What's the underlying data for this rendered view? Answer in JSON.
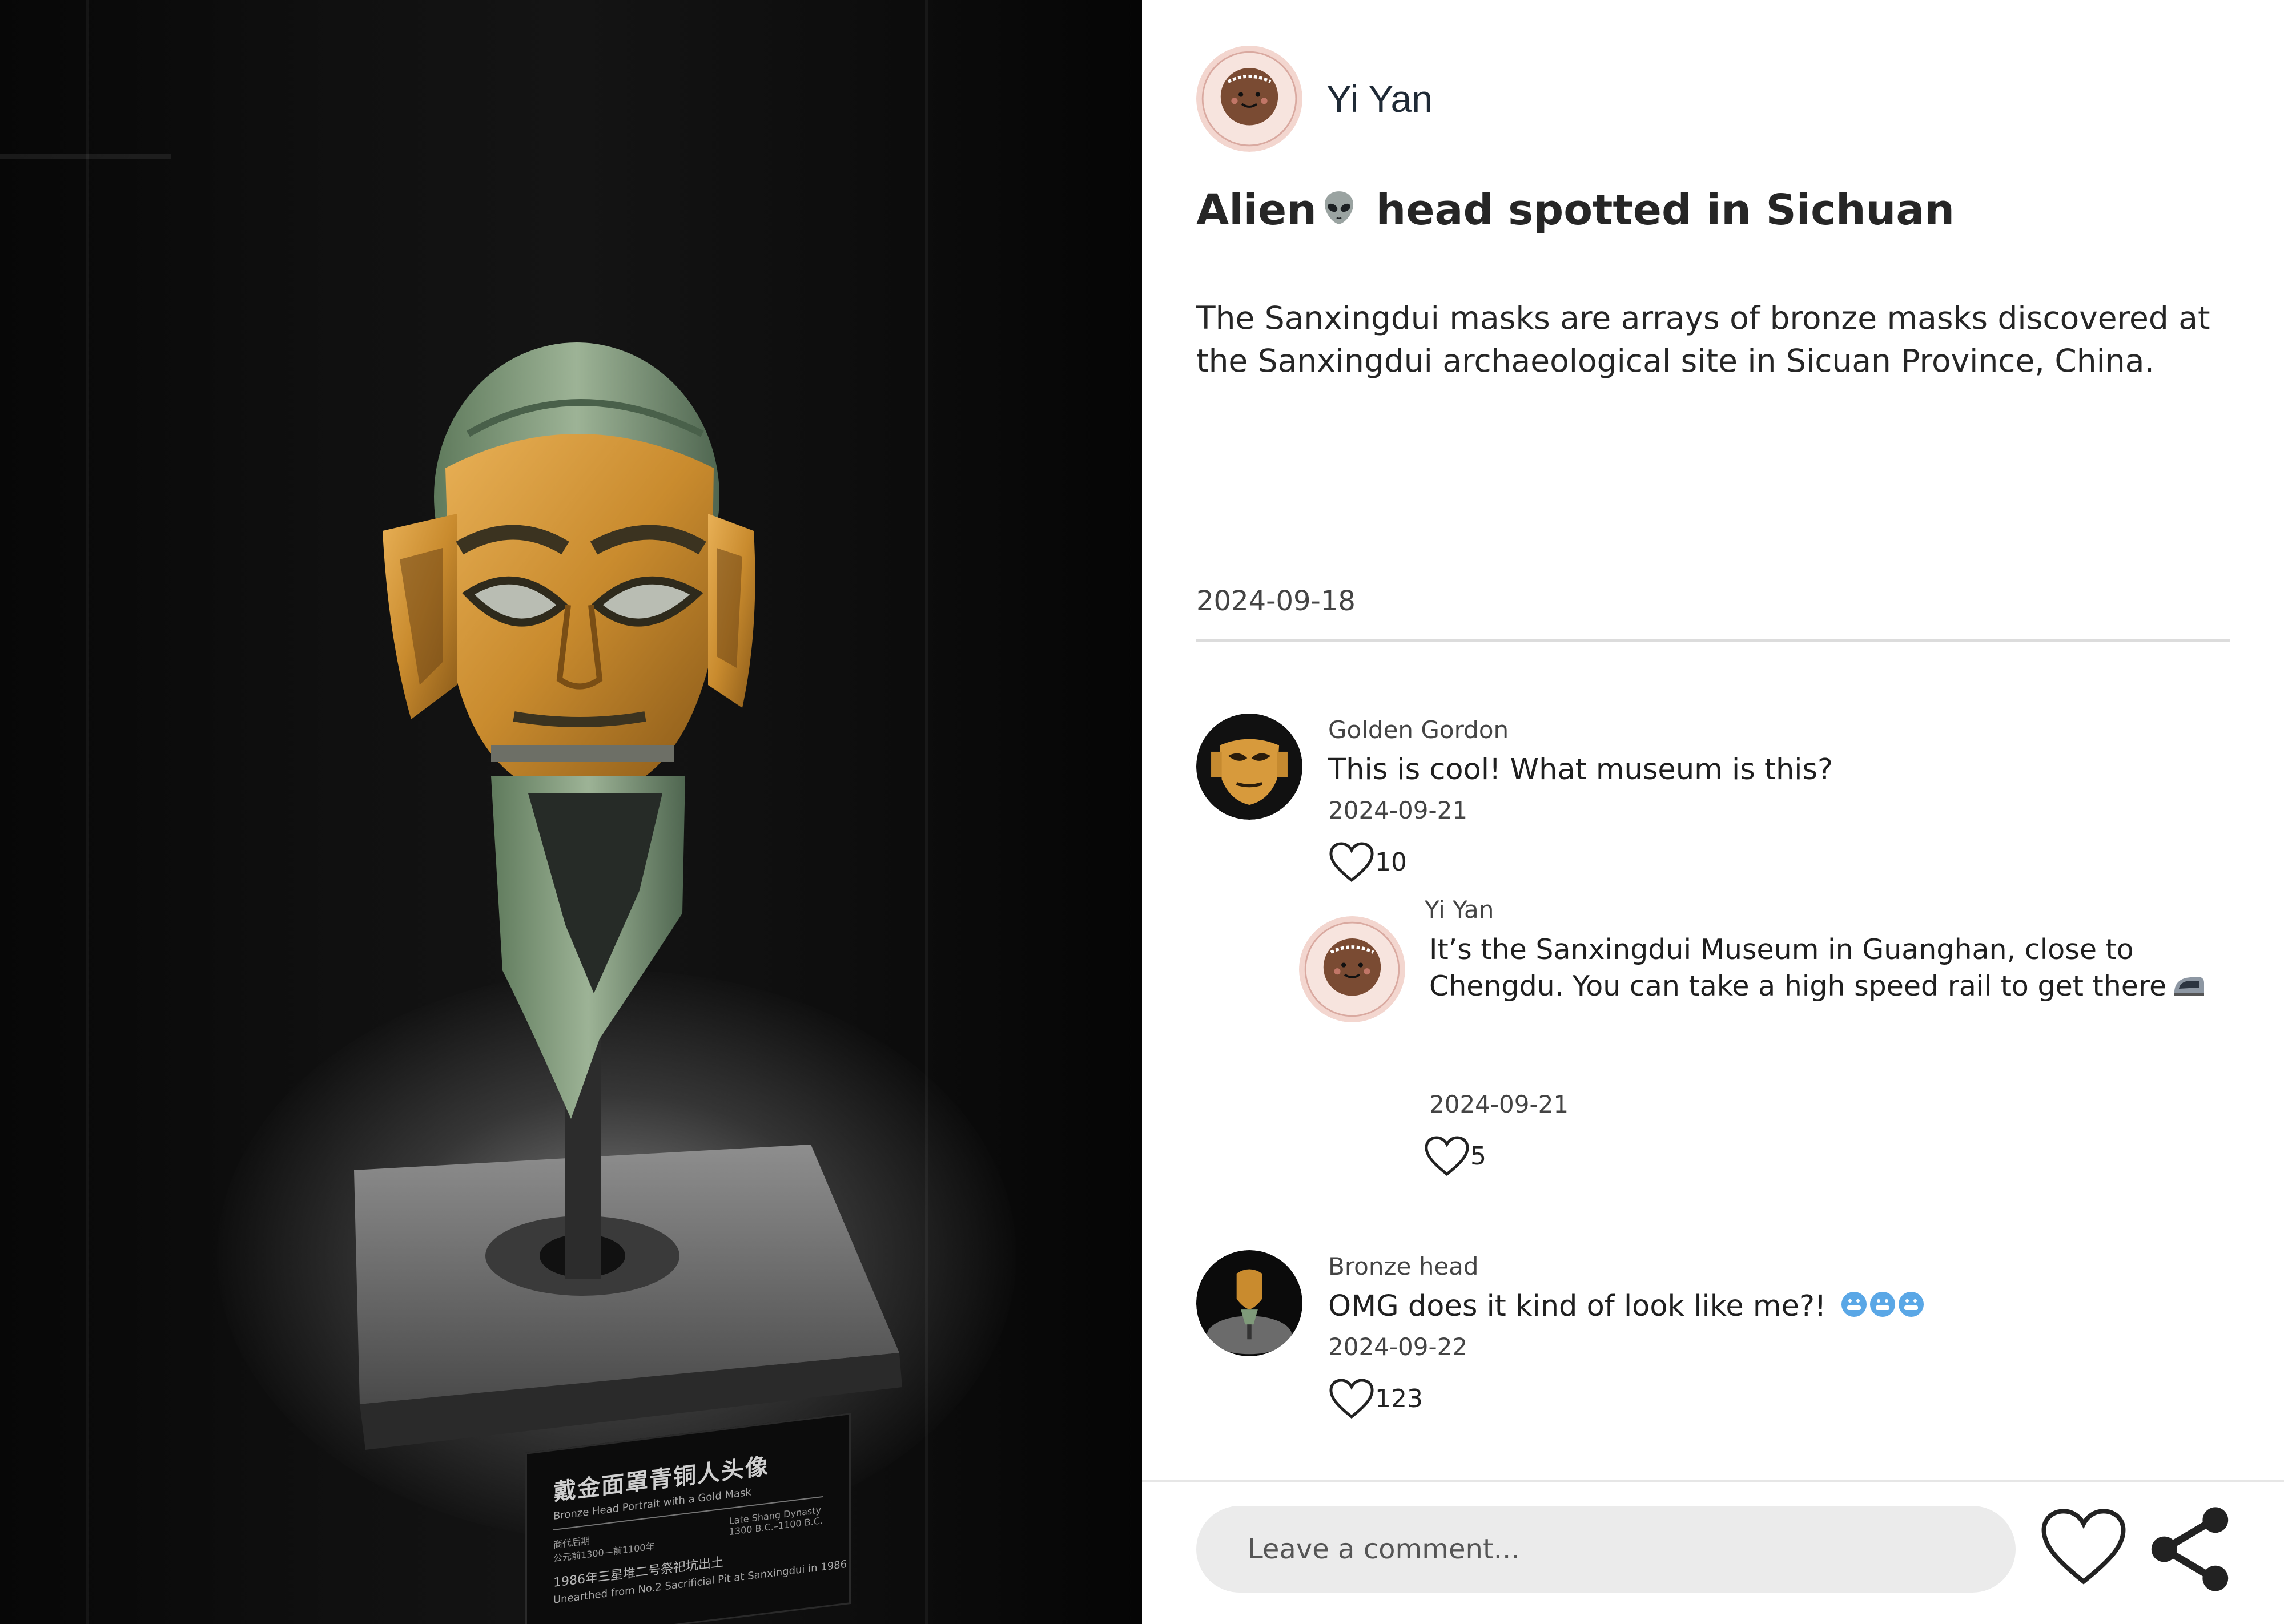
{
  "photo": {
    "subject": "bronze head",
    "plaque": {
      "title_zh": "戴金面罩青铜人头像",
      "title_en": "Bronze Head Portrait with a Gold Mask",
      "period_zh": "商代后期",
      "period_en": "Late Shang Dynasty",
      "date_zh": "公元前1300—前1100年",
      "date_en": "1300 B.C.–1100 B.C.",
      "found_zh": "1986年三星堆二号祭祀坑出土",
      "found_en": "Unearthed from No.2 Sacrificial Pit at Sanxingdui in 1986"
    }
  },
  "post": {
    "author": "Yi Yan",
    "title_before": "Alien",
    "title_emoji": "alien-emoji",
    "title_after": " head spotted in Sichuan",
    "body": "The Sanxingdui masks are arrays of bronze masks discovered at the Sanxingdui archaeological site in Sicuan Province, China.",
    "date": "2024-09-18"
  },
  "comments": [
    {
      "author": "Golden Gordon",
      "avatar": "gold-mask-avatar",
      "text": "This is cool! What museum is this?",
      "date": "2024-09-21",
      "likes": "10"
    },
    {
      "author": "Bronze head",
      "avatar": "bronze-head-avatar",
      "text": "OMG does it kind of look like me?!",
      "emojis": "cold-face-emoji x3",
      "date": "2024-09-22",
      "likes": "123"
    }
  ],
  "reply": {
    "author": "Yi Yan",
    "avatar": "sun-face-avatar",
    "text": "It’s the Sanxingdui Museum in Guanghan, close to Chengdu. You can take a high speed rail to get there",
    "emoji": "high-speed-train-emoji",
    "date": "2024-09-21",
    "likes": "5"
  },
  "composer": {
    "placeholder": "Leave a comment...",
    "like_icon": "heart-icon",
    "share_icon": "share-icon"
  },
  "colors": {
    "text": "#262626",
    "muted": "#444444",
    "input_bg": "#ebebeb",
    "divider": "#dcdcdc",
    "gold": "#c98b2e",
    "bronze": "#7f9a7a"
  }
}
